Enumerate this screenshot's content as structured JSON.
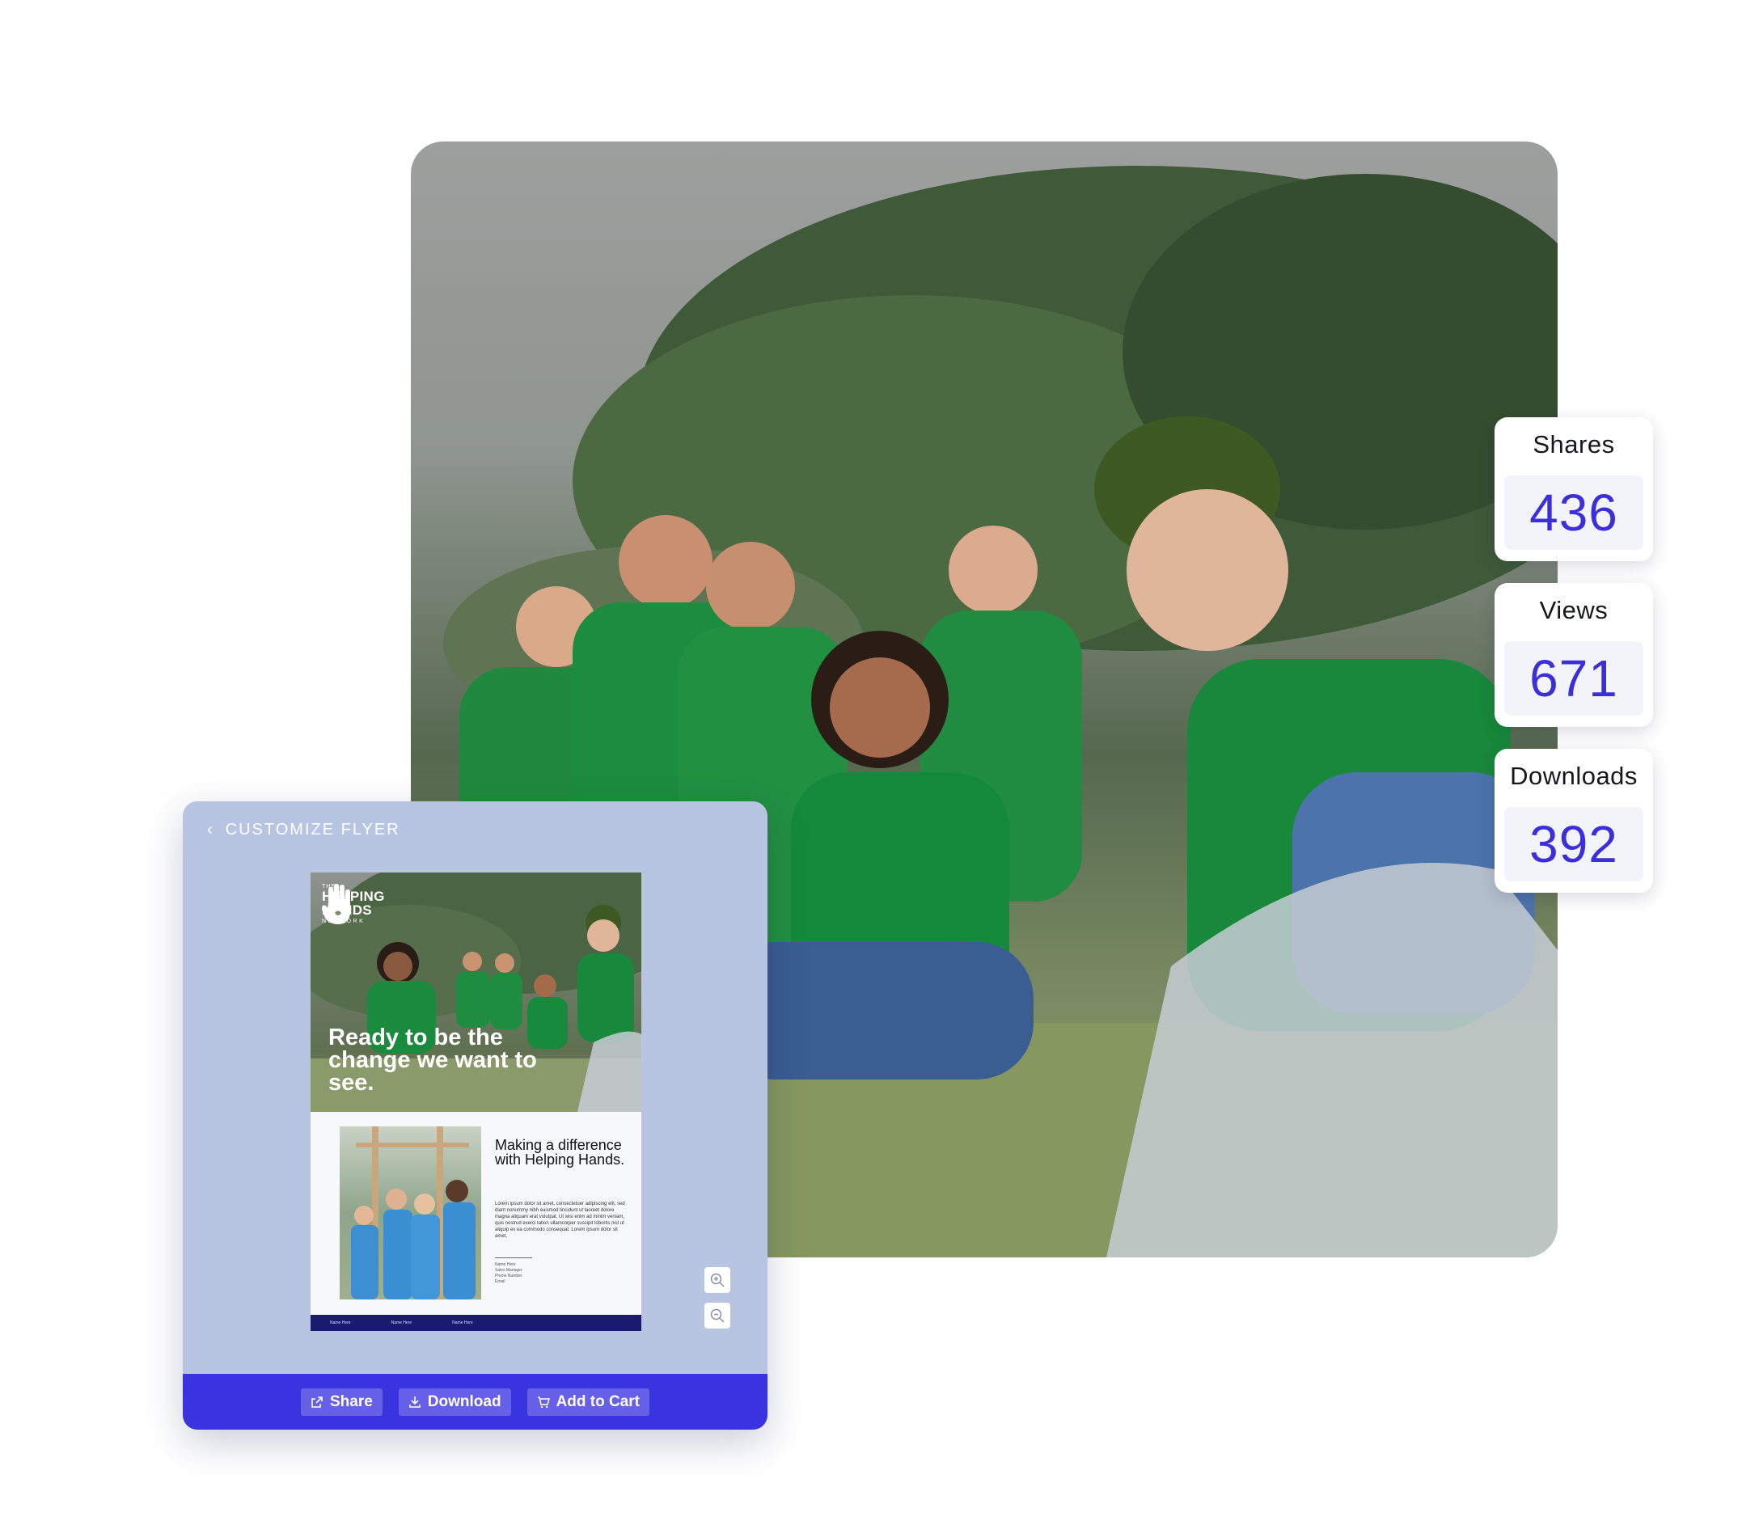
{
  "stats": [
    {
      "label": "Shares",
      "value": "436"
    },
    {
      "label": "Views",
      "value": "671"
    },
    {
      "label": "Downloads",
      "value": "392"
    }
  ],
  "panel": {
    "back_label": "CUSTOMIZE FLYER",
    "flyer": {
      "logo": {
        "the": "THE",
        "line1": "HELPING",
        "line2": "HANDS",
        "network": "NETWORK"
      },
      "headline": "Ready to be the change we want to see.",
      "subhead": "Making a difference with Helping Hands.",
      "body": "Lorem ipsum dolor sit amet, consectetuer adipiscing elit, sed diam nonummy nibh euismod tincidunt ut laoreet dolore magna aliquam erat volutpat. Ut wisi enim ad minim veniam, quis nostrud exerci tation ullamcorper suscipit lobortis nisl ut aliquip ex ea commodo consequat. Lorem ipsum dolor sit amet,",
      "contact": {
        "name": "Name Here",
        "title": "Sales Manager",
        "phone": "Phone Number",
        "email": "Email"
      },
      "footer": [
        "Name Here",
        "Name Here",
        "Name Here"
      ]
    },
    "zoom_in_icon": "zoom-in-icon",
    "zoom_out_icon": "zoom-out-icon",
    "actions": {
      "share": "Share",
      "download": "Download",
      "add_to_cart": "Add to Cart"
    }
  },
  "colors": {
    "accent": "#3a34e0",
    "stat_value": "#3a2fd9",
    "panel_bg": "#b7c5e3",
    "flyer_footer": "#1a1b6e"
  }
}
